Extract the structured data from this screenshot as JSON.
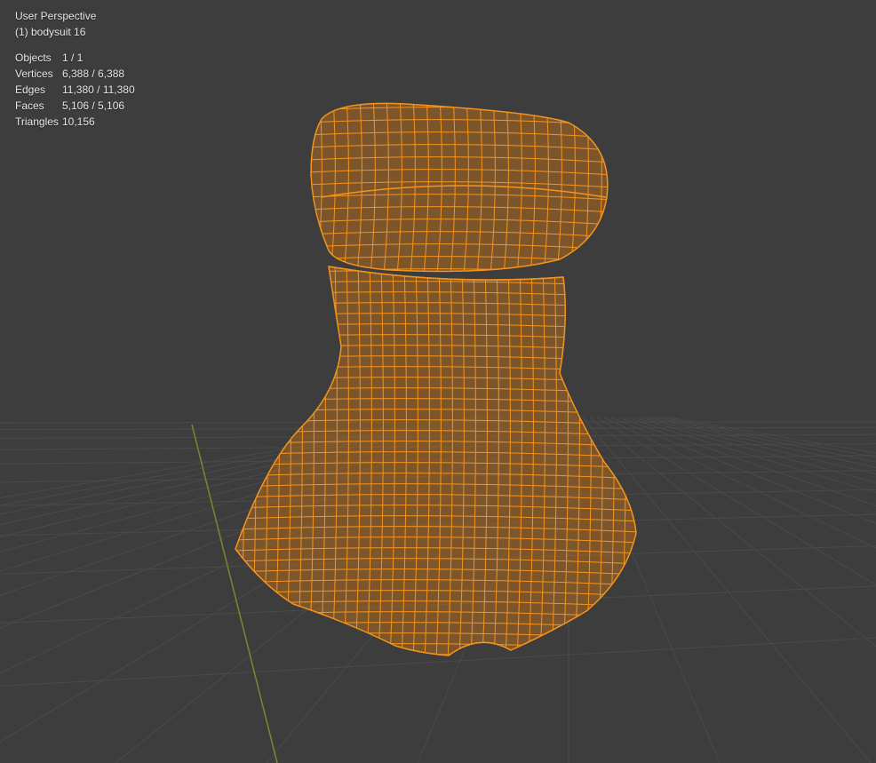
{
  "viewport": {
    "view_name": "User Perspective",
    "object_info": "(1) bodysuit 16"
  },
  "stats": [
    {
      "label": "Objects",
      "value": "1 / 1"
    },
    {
      "label": "Vertices",
      "value": "6,388 / 6,388"
    },
    {
      "label": "Edges",
      "value": "11,380 / 11,380"
    },
    {
      "label": "Faces",
      "value": "5,106 / 5,106"
    },
    {
      "label": "Triangles",
      "value": "10,156"
    }
  ],
  "colors": {
    "background": "#3d3d3d",
    "grid": "#4a4a4a",
    "y_axis": "#6c8a2e",
    "wire": "#f5941d",
    "fill": "#b36a1e"
  }
}
